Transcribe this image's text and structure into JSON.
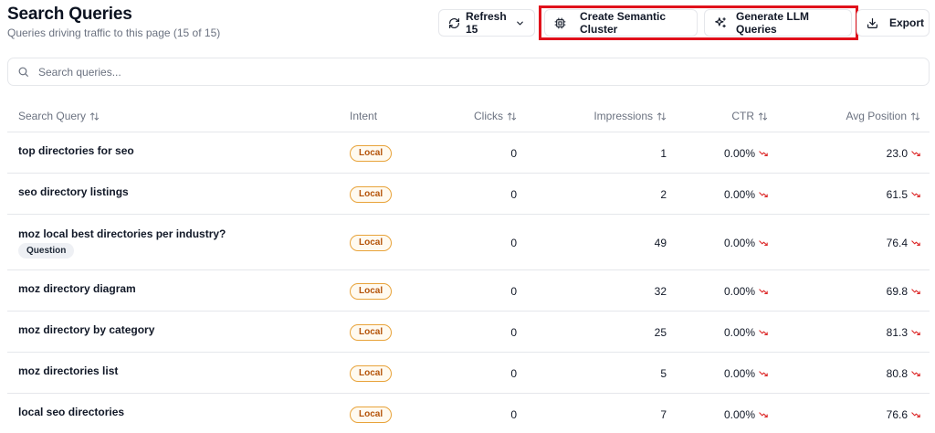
{
  "header": {
    "title": "Search Queries",
    "subtitle": "Queries driving traffic to this page (15 of 15)"
  },
  "toolbar": {
    "refresh_label": "Refresh 15",
    "cluster_label": "Create Semantic Cluster",
    "llm_label": "Generate LLM Queries",
    "export_label": "Export",
    "highlight_color": "#e0111b"
  },
  "search": {
    "placeholder": "Search queries..."
  },
  "table": {
    "columns": {
      "query": "Search Query",
      "intent": "Intent",
      "clicks": "Clicks",
      "impressions": "Impressions",
      "ctr": "CTR",
      "position": "Avg Position"
    },
    "rows": [
      {
        "query": "top directories for seo",
        "tag": "",
        "intent": "Local",
        "clicks": "0",
        "impressions": "1",
        "ctr": "0.00%",
        "position": "23.0"
      },
      {
        "query": "seo directory listings",
        "tag": "",
        "intent": "Local",
        "clicks": "0",
        "impressions": "2",
        "ctr": "0.00%",
        "position": "61.5"
      },
      {
        "query": "moz local best directories per industry?",
        "tag": "Question",
        "intent": "Local",
        "clicks": "0",
        "impressions": "49",
        "ctr": "0.00%",
        "position": "76.4"
      },
      {
        "query": "moz directory diagram",
        "tag": "",
        "intent": "Local",
        "clicks": "0",
        "impressions": "32",
        "ctr": "0.00%",
        "position": "69.8"
      },
      {
        "query": "moz directory by category",
        "tag": "",
        "intent": "Local",
        "clicks": "0",
        "impressions": "25",
        "ctr": "0.00%",
        "position": "81.3"
      },
      {
        "query": "moz directories list",
        "tag": "",
        "intent": "Local",
        "clicks": "0",
        "impressions": "5",
        "ctr": "0.00%",
        "position": "80.8"
      },
      {
        "query": "local seo directories",
        "tag": "",
        "intent": "Local",
        "clicks": "0",
        "impressions": "7",
        "ctr": "0.00%",
        "position": "76.6"
      }
    ]
  },
  "colors": {
    "intent_local": "#e8a33a",
    "trend_down": "#dc2626"
  },
  "icons": [
    "refresh-icon",
    "chevron-down-icon",
    "cpu-icon",
    "sparkles-icon",
    "download-icon",
    "search-icon",
    "sort-icon",
    "trend-down-icon"
  ]
}
